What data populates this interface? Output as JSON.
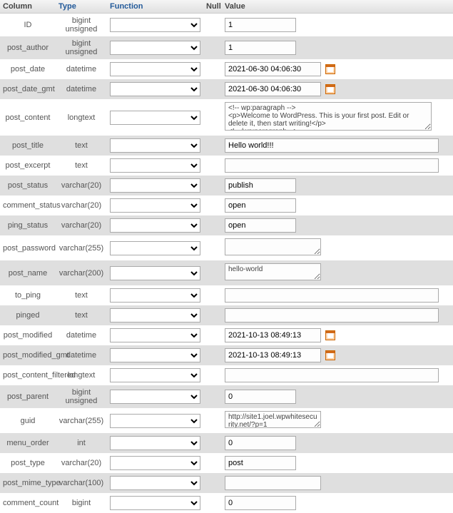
{
  "header": {
    "column": "Column",
    "type": "Type",
    "function": "Function",
    "null": "Null",
    "value": "Value"
  },
  "rows": [
    {
      "name": "ID",
      "type": "bigint unsigned",
      "widget": "number",
      "value": "1"
    },
    {
      "name": "post_author",
      "type": "bigint unsigned",
      "widget": "number",
      "value": "1"
    },
    {
      "name": "post_date",
      "type": "datetime",
      "widget": "datetime",
      "value": "2021-06-30 04:06:30"
    },
    {
      "name": "post_date_gmt",
      "type": "datetime",
      "widget": "datetime",
      "value": "2021-06-30 04:06:30"
    },
    {
      "name": "post_content",
      "type": "longtext",
      "widget": "textarea",
      "value": "<!-- wp:paragraph -->\n<p>Welcome to WordPress. This is your first post. Edit or delete it, then start writing!</p>\n<!-- /wp:paragraph -->"
    },
    {
      "name": "post_title",
      "type": "text",
      "widget": "textwide",
      "value": "Hello world!!!"
    },
    {
      "name": "post_excerpt",
      "type": "text",
      "widget": "textwide",
      "value": ""
    },
    {
      "name": "post_status",
      "type": "varchar(20)",
      "widget": "text",
      "value": "publish"
    },
    {
      "name": "comment_status",
      "type": "varchar(20)",
      "widget": "text",
      "value": "open"
    },
    {
      "name": "ping_status",
      "type": "varchar(20)",
      "widget": "text",
      "value": "open"
    },
    {
      "name": "post_password",
      "type": "varchar(255)",
      "widget": "textarea-short",
      "value": ""
    },
    {
      "name": "post_name",
      "type": "varchar(200)",
      "widget": "textarea-short",
      "value": "hello-world"
    },
    {
      "name": "to_ping",
      "type": "text",
      "widget": "textwide",
      "value": ""
    },
    {
      "name": "pinged",
      "type": "text",
      "widget": "textwide",
      "value": ""
    },
    {
      "name": "post_modified",
      "type": "datetime",
      "widget": "datetime",
      "value": "2021-10-13 08:49:13"
    },
    {
      "name": "post_modified_gmt",
      "type": "datetime",
      "widget": "datetime",
      "value": "2021-10-13 08:49:13"
    },
    {
      "name": "post_content_filtered",
      "type": "longtext",
      "widget": "textwide",
      "value": ""
    },
    {
      "name": "post_parent",
      "type": "bigint unsigned",
      "widget": "number",
      "value": "0"
    },
    {
      "name": "guid",
      "type": "varchar(255)",
      "widget": "textarea-short",
      "value": "http://site1.joel.wpwhitesecurity.net/?p=1"
    },
    {
      "name": "menu_order",
      "type": "int",
      "widget": "number",
      "value": "0"
    },
    {
      "name": "post_type",
      "type": "varchar(20)",
      "widget": "text",
      "value": "post"
    },
    {
      "name": "post_mime_type",
      "type": "varchar(100)",
      "widget": "textmed",
      "value": ""
    },
    {
      "name": "comment_count",
      "type": "bigint",
      "widget": "number",
      "value": "0"
    }
  ]
}
